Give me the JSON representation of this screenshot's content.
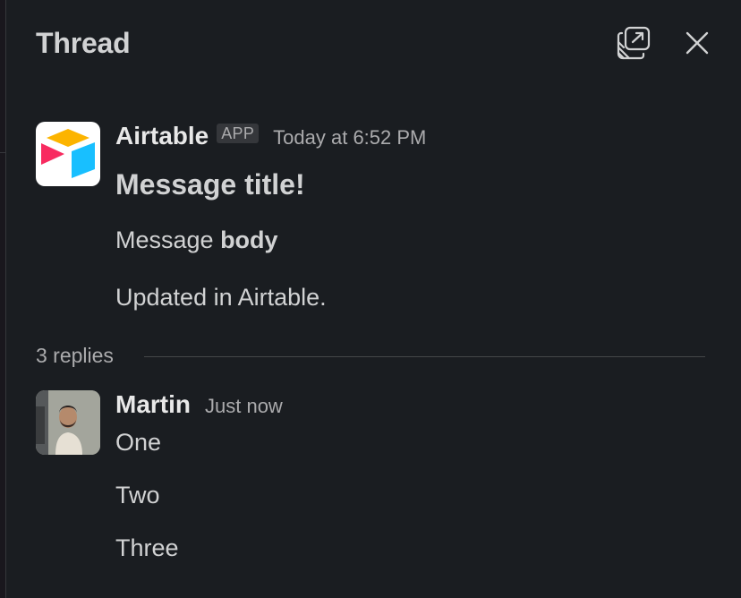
{
  "header": {
    "title": "Thread",
    "popout_icon": "popout-icon",
    "close_icon": "close-icon"
  },
  "parent_message": {
    "sender": "Airtable",
    "badge": "APP",
    "timestamp": "Today at 6:52 PM",
    "title": "Message title!",
    "body_prefix": "Message ",
    "body_bold": "body",
    "footer": "Updated in Airtable."
  },
  "replies": {
    "label": "3 replies"
  },
  "reply_message": {
    "sender": "Martin",
    "timestamp": "Just now",
    "lines": [
      "One",
      "Two",
      "Three"
    ]
  },
  "colors": {
    "background": "#1a1d21",
    "text": "#d1d2d3",
    "muted": "#ababad"
  }
}
